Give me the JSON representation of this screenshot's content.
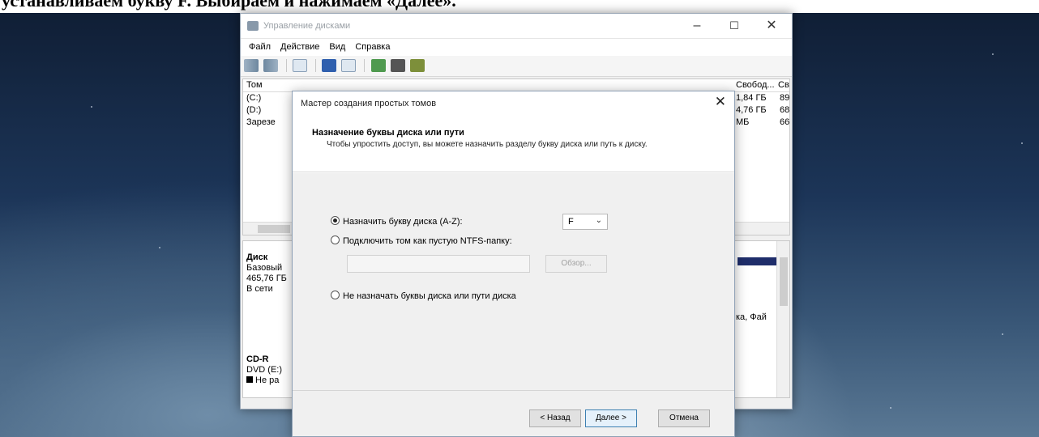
{
  "caption": {
    "text": "устанавливаем букву F. Выбираем и нажимаем «Далее»."
  },
  "disk_manager": {
    "title": "Управление дисками",
    "controls": {
      "minimize": "–",
      "maximize": "☐",
      "close": "✕"
    },
    "menu": [
      "Файл",
      "Действие",
      "Вид",
      "Справка"
    ],
    "volumes": {
      "headers": {
        "volume": "Том",
        "free": "Свобод...",
        "pct": "Св"
      },
      "rows": [
        {
          "name": "(C:)",
          "free": "1,84 ГБ",
          "pct": "89"
        },
        {
          "name": "(D:)",
          "free": "4,76 ГБ",
          "pct": "68"
        },
        {
          "name": "Зарезе",
          "free": "МБ",
          "pct": "66"
        }
      ]
    },
    "disks": {
      "disk0": {
        "name": "Диск",
        "type": "Базовый",
        "size": "465,76 ГБ",
        "status": "В сети",
        "partition_fs": "ка, Фай"
      },
      "cdrom": {
        "name": "CD-R",
        "drive": "DVD (E:)",
        "legend": "Не ра"
      }
    }
  },
  "wizard": {
    "title": "Мастер создания простых томов",
    "heading": "Назначение буквы диска или пути",
    "description": "Чтобы упростить доступ, вы можете назначить разделу букву диска или путь к диску.",
    "options": {
      "assign_letter": "Назначить букву диска (A-Z):",
      "mount_folder": "Подключить том как пустую NTFS-папку:",
      "no_letter": "Не назначать буквы диска или пути диска"
    },
    "selected_letter": "F",
    "path_value": "",
    "browse": "Обзор...",
    "buttons": {
      "back": "< Назад",
      "next": "Далее >",
      "cancel": "Отмена"
    }
  }
}
